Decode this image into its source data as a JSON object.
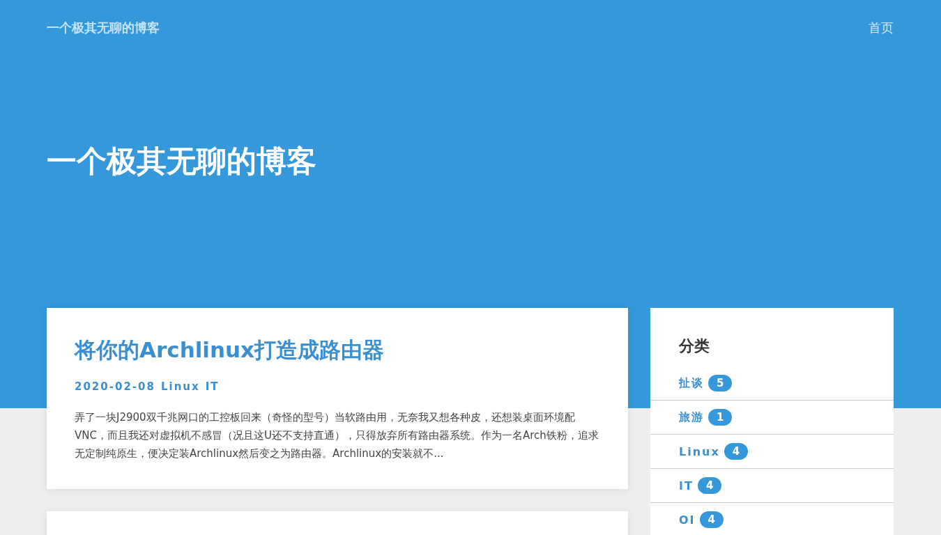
{
  "nav": {
    "site_title": "一个极其无聊的博客",
    "links": [
      "首页"
    ]
  },
  "hero": {
    "title": "一个极其无聊的博客"
  },
  "posts": [
    {
      "kind": "full",
      "title": "将你的Archlinux打造成路由器",
      "date": "2020-02-08",
      "tags": [
        "Linux",
        "IT"
      ],
      "excerpt": "弄了一块J2900双千兆网口的工控板回来（奇怪的型号）当软路由用，无奈我又想各种皮，还想装桌面环境配VNC，而且我还对虚拟机不感冒（况且这U还不支持直通），只得放弃所有路由器系统。作为一名Arch铁粉，追求无定制纯原生，便决定装Archlinux然后变之为路由器。Archlinux的安装就不..."
    },
    {
      "kind": "cut-off"
    }
  ],
  "sidebar": {
    "heading": "分类",
    "categories": [
      {
        "name": "扯谈",
        "count": "5"
      },
      {
        "name": "旅游",
        "count": "1"
      },
      {
        "name": "Linux",
        "count": "4"
      },
      {
        "name": "IT",
        "count": "4"
      },
      {
        "name": "OI",
        "count": "4"
      }
    ]
  }
}
